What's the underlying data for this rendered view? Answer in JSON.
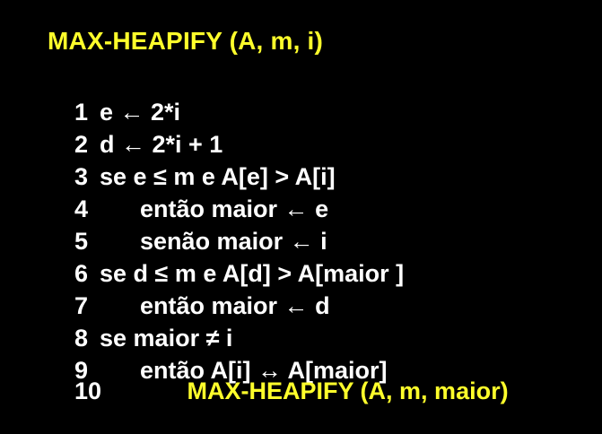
{
  "title": "MAX-HEAPIFY (A, m, i)",
  "lines": [
    {
      "num": "1",
      "text": "e ← 2*i"
    },
    {
      "num": "2",
      "text": "d ← 2*i + 1"
    },
    {
      "num": "3",
      "text": "se e ≤ m e A[e] > A[i]"
    },
    {
      "num": "4",
      "text": "      então maior ← e"
    },
    {
      "num": "5",
      "text": "      senão maior ← i"
    },
    {
      "num": "6",
      "text": "se d ≤ m e A[d] > A[maior ]"
    },
    {
      "num": "7",
      "text": "      então maior ← d"
    },
    {
      "num": "8",
      "text": "se maior ≠ i"
    },
    {
      "num": "9",
      "text": "      então A[i] ↔ A[maior]"
    },
    {
      "num": "10",
      "text": "             MAX-HEAPIFY (A, m, maior)"
    }
  ],
  "colors": {
    "background": "#000000",
    "text": "#ffffff",
    "highlight": "#ffff2b"
  }
}
